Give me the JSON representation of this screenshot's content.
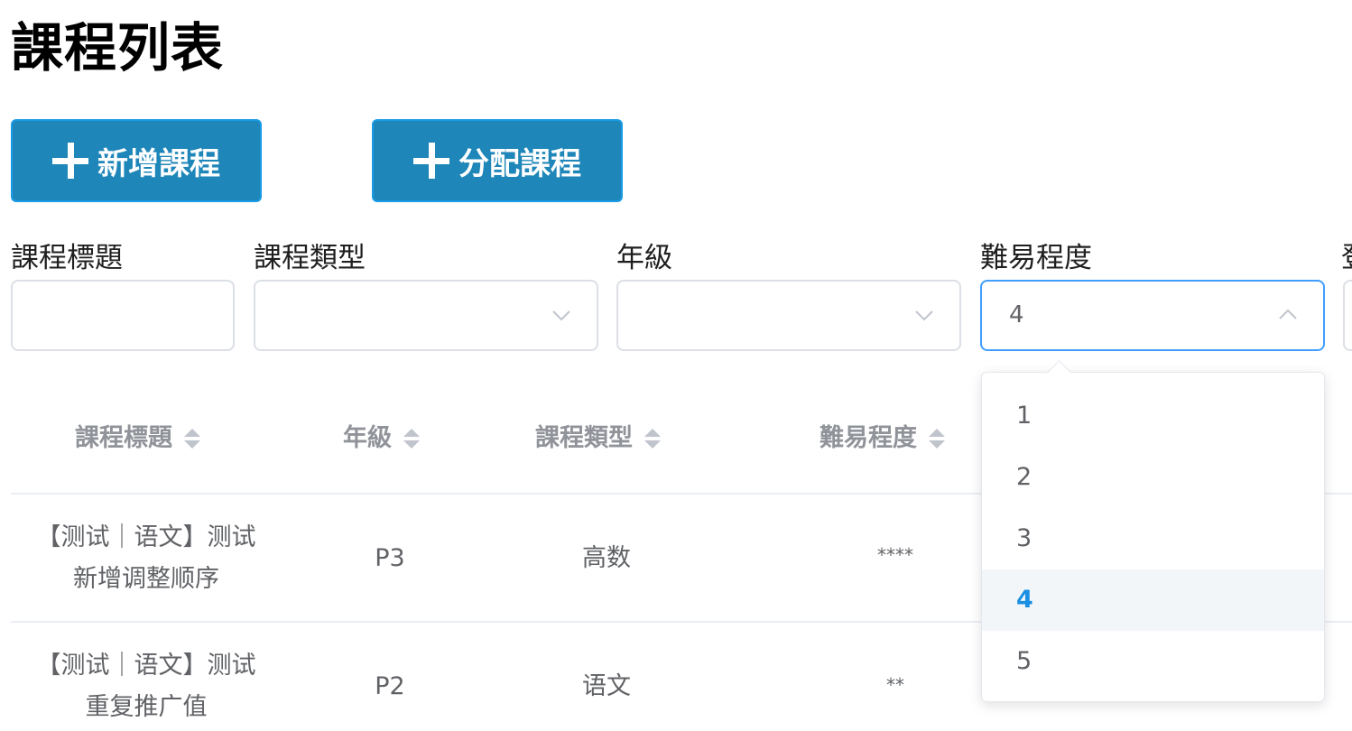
{
  "header": {
    "title": "課程列表"
  },
  "toolbar": {
    "add_course_label": "新增課程",
    "assign_course_label": "分配課程"
  },
  "filters": {
    "title_label": "課程標題",
    "type_label": "課程類型",
    "grade_label": "年級",
    "difficulty_label": "難易程度",
    "difficulty_value": "4",
    "cut_label": "登"
  },
  "dropdown": {
    "options": [
      "1",
      "2",
      "3",
      "4",
      "5"
    ],
    "selected": "4"
  },
  "table": {
    "columns": [
      "課程標題",
      "年級",
      "課程類型",
      "難易程度"
    ],
    "rows": [
      {
        "title_line1": "【测试｜语文】测试",
        "title_line2": "新增调整顺序",
        "grade": "P3",
        "type": "高数",
        "difficulty": "****"
      },
      {
        "title_line1": "【测试｜语文】测试",
        "title_line2": "重复推广值",
        "grade": "P2",
        "type": "语文",
        "difficulty": "**"
      }
    ]
  },
  "colors": {
    "primary_button": "#1e86b8",
    "accent": "#409eff",
    "selected_text": "#1a8fe3"
  }
}
